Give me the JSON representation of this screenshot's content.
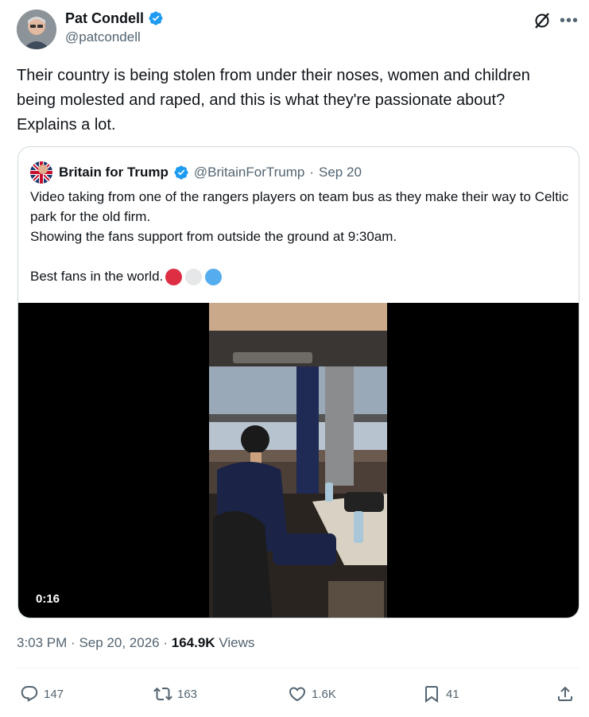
{
  "author": {
    "name": "Pat Condell",
    "handle": "@patcondell"
  },
  "tweet": {
    "text": "Their country is being stolen from under their noses, women and children being molested and raped, and this is what they're passionate about? Explains a lot."
  },
  "quote": {
    "name": "Britain for Trump",
    "handle": "@BritainForTrump",
    "dot": "·",
    "date": "Sep 20",
    "text": "Video taking from one of the rangers players on team bus as they make their way to Celtic park for the old firm.\nShowing the fans support from outside the ground at 9:30am.\n\nBest fans in the world.",
    "emoji_colors": [
      "#dd2e44",
      "#e6e7e8",
      "#55acee"
    ],
    "video_duration": "0:16"
  },
  "meta": {
    "time": "3:03 PM",
    "sep1": "·",
    "date": "Sep 20, 2026",
    "sep2": "·",
    "views_count": "164.9K",
    "views_label": "Views"
  },
  "actions": {
    "replies": "147",
    "reposts": "163",
    "likes": "1.6K",
    "bookmarks": "41"
  },
  "colors": {
    "verified": "#1d9bf0",
    "secondary_text": "#536471",
    "border": "#cfd9de"
  },
  "icons": [
    "verified-badge-icon",
    "grok-icon",
    "more-icon",
    "reply-icon",
    "repost-icon",
    "like-icon",
    "bookmark-icon",
    "share-icon"
  ]
}
